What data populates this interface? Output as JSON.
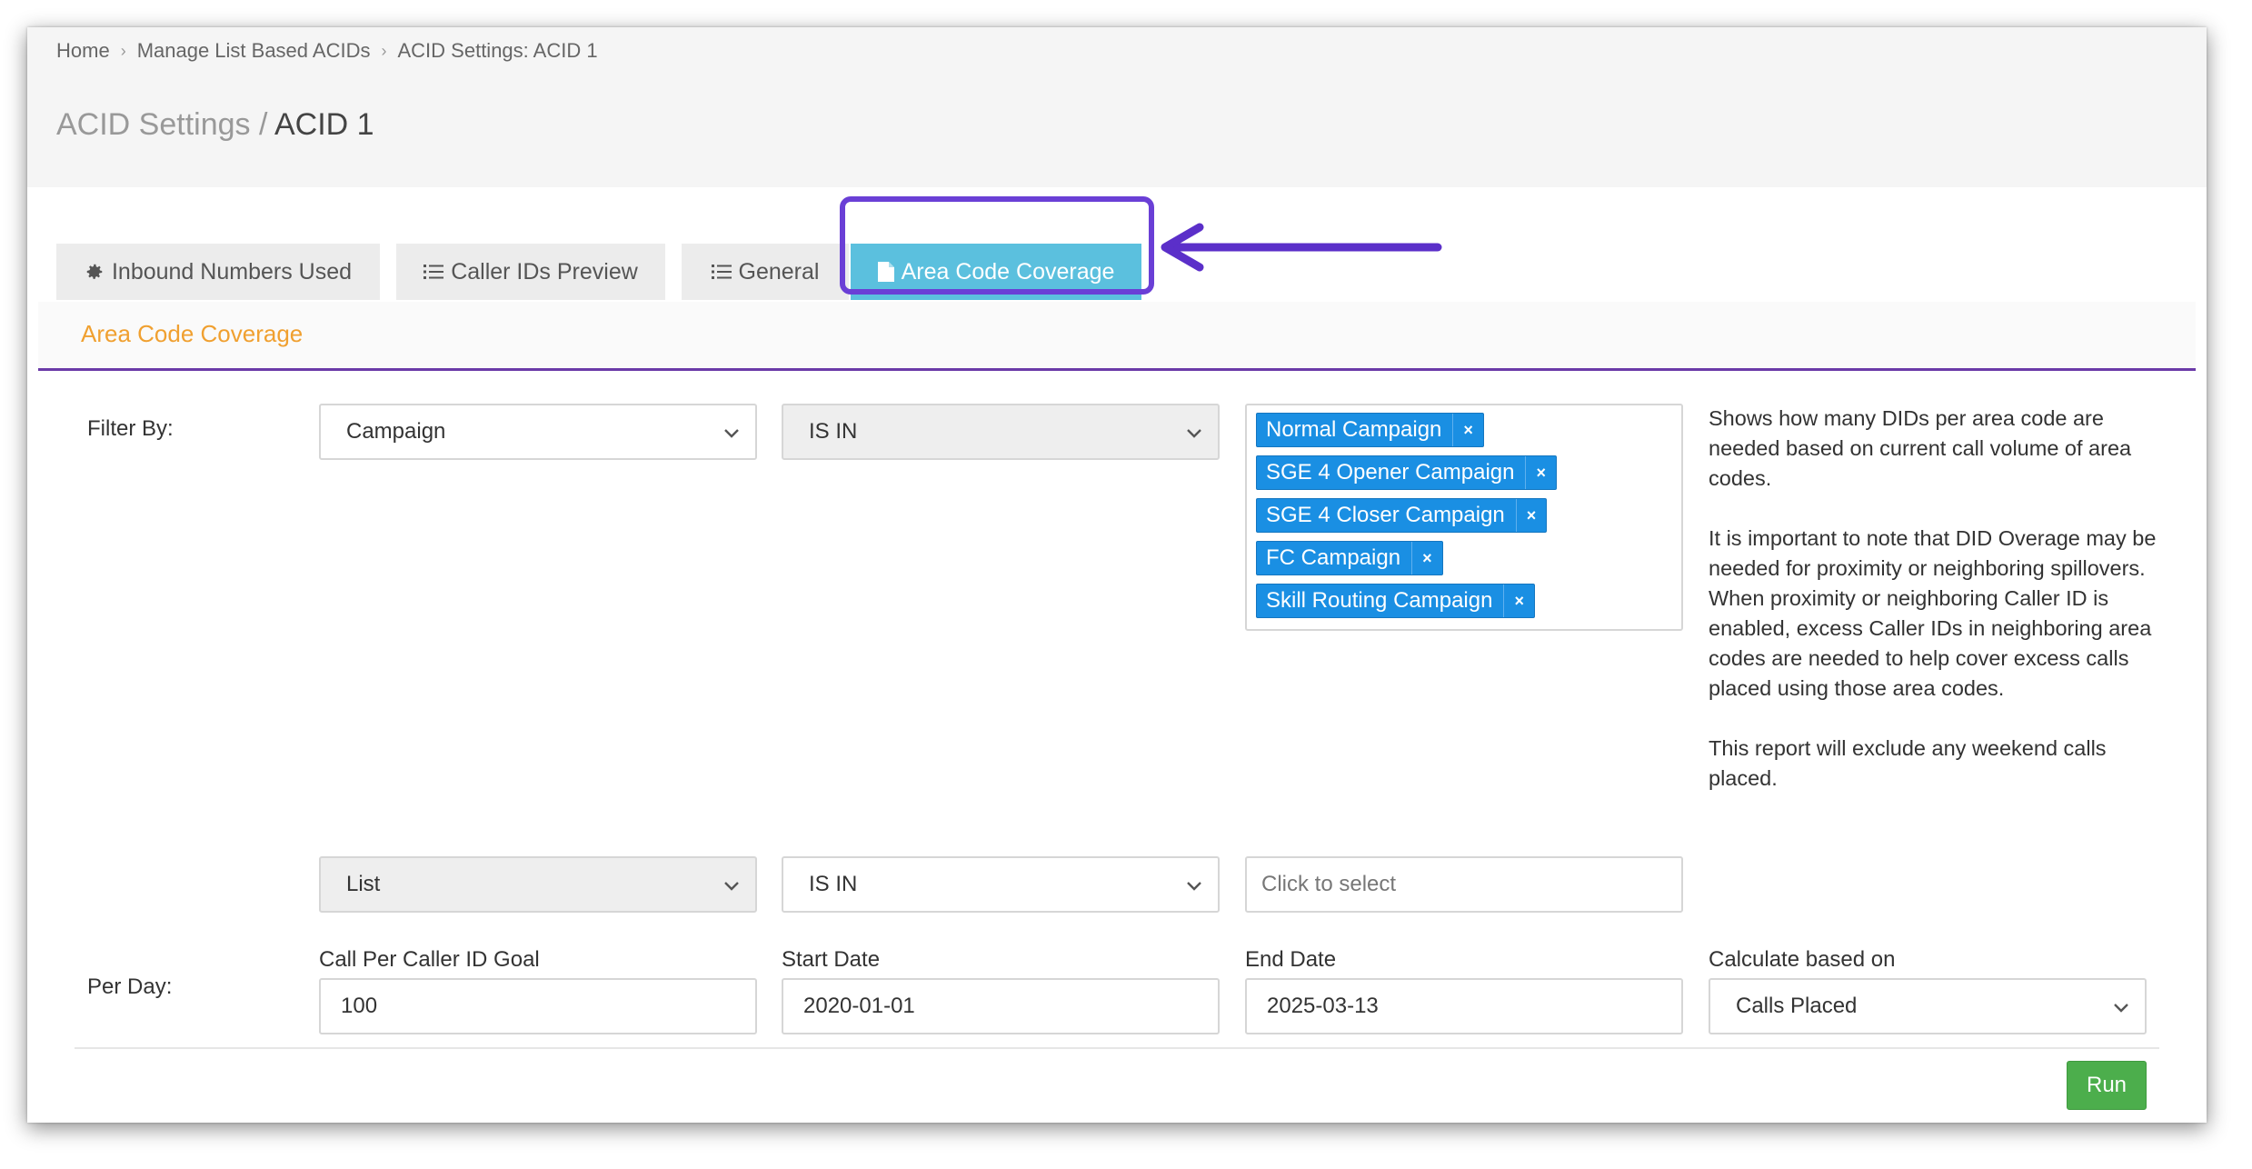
{
  "breadcrumb": {
    "items": [
      "Home",
      "Manage List Based ACIDs",
      "ACID Settings: ACID 1"
    ]
  },
  "page_title": {
    "prefix": "ACID Settings",
    "separator": " / ",
    "current": "ACID 1"
  },
  "tabs": [
    {
      "label": "Inbound Numbers Used",
      "icon": "gear-icon"
    },
    {
      "label": "Caller IDs Preview",
      "icon": "list-icon"
    },
    {
      "label": "General",
      "icon": "list-icon"
    },
    {
      "label": "Area Code Coverage",
      "icon": "file-icon",
      "active": true
    }
  ],
  "section": {
    "title": "Area Code Coverage"
  },
  "filter": {
    "label": "Filter By:",
    "row1": {
      "field": "Campaign",
      "operator": "IS IN",
      "tags": [
        "Normal Campaign",
        "SGE 4 Opener Campaign",
        "SGE 4 Closer Campaign",
        "FC Campaign",
        "Skill Routing Campaign"
      ],
      "remove_symbol": "×"
    },
    "row2": {
      "field": "List",
      "operator": "IS IN",
      "placeholder": "Click to select"
    }
  },
  "help_text": [
    "Shows how many DIDs per area code are needed based on current call volume of area codes.",
    "It is important to note that DID Overage may be needed for proximity or neighboring spillovers. When proximity or neighboring Caller ID is enabled, excess Caller IDs in neighboring area codes are needed to help cover excess calls placed using those area codes.",
    "This report will exclude any weekend calls placed."
  ],
  "per_day": {
    "label": "Per Day:",
    "goal": {
      "label": "Call Per Caller ID Goal",
      "value": "100"
    },
    "start_date": {
      "label": "Start Date",
      "value": "2020-01-01"
    },
    "end_date": {
      "label": "End Date",
      "value": "2025-03-13"
    },
    "calculate": {
      "label": "Calculate based on",
      "value": "Calls Placed"
    }
  },
  "run_button": {
    "label": "Run"
  },
  "colors": {
    "accent_tab": "#5bc0de",
    "highlight": "#6a3fd6",
    "section_title": "#f0a030",
    "tag": "#1a8fe3",
    "run": "#4cae4c"
  }
}
